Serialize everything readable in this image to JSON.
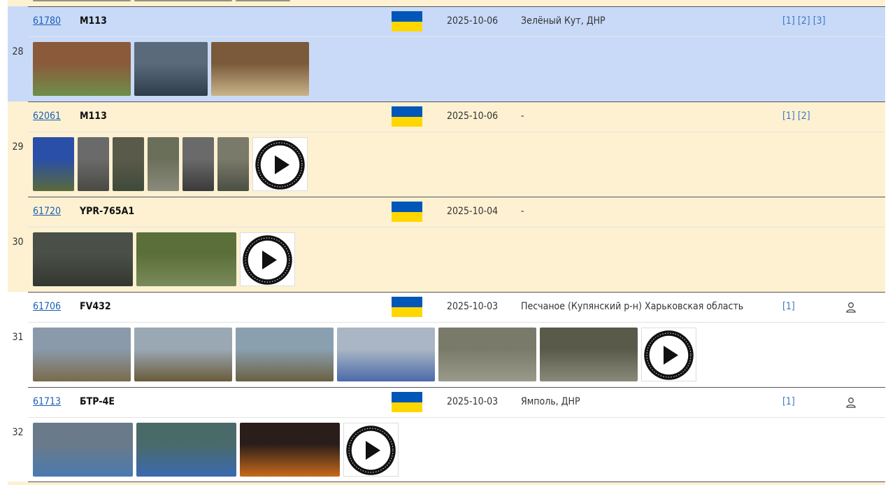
{
  "colors": {
    "row_blue": "#c9daf8",
    "row_yellow": "#fdf1d2",
    "link": "#1a5fb4",
    "flag_blue": "#0057b7",
    "flag_yellow": "#ffd700"
  },
  "rows": [
    {
      "num": "28",
      "bg": "blue",
      "id": "61780",
      "model": "M113",
      "flag": "ukraine-flag",
      "date": "2025-10-06",
      "location": "Зелёный Кут, ДНР",
      "links": [
        "[1]",
        "[2]",
        "[3]"
      ],
      "person": false,
      "thumbs": [
        {
          "w": 140,
          "c1": "#8a5a3a",
          "c2": "#6f8f4a"
        },
        {
          "w": 105,
          "c1": "#5a6a7a",
          "c2": "#2f3d4a"
        },
        {
          "w": 140,
          "c1": "#7a5a3a",
          "c2": "#c9b48a"
        }
      ],
      "video": false
    },
    {
      "num": "29",
      "bg": "yellow",
      "id": "62061",
      "model": "M113",
      "flag": "ukraine-flag",
      "date": "2025-10-06",
      "location": "-",
      "links": [
        "[1]",
        "[2]"
      ],
      "person": false,
      "thumbs": [
        {
          "w": 59,
          "c1": "#2a4fa8",
          "c2": "#5a6a3a"
        },
        {
          "w": 45,
          "c1": "#6a6a6a",
          "c2": "#4a4a44"
        },
        {
          "w": 45,
          "c1": "#5a5a4a",
          "c2": "#3f4a3a"
        },
        {
          "w": 45,
          "c1": "#6a6f5a",
          "c2": "#8a8a7a"
        },
        {
          "w": 45,
          "c1": "#6a6a6a",
          "c2": "#3a3a3a"
        },
        {
          "w": 45,
          "c1": "#7a7a6a",
          "c2": "#4a4f44"
        }
      ],
      "video": true
    },
    {
      "num": "30",
      "bg": "yellow",
      "id": "61720",
      "model": "YPR-765A1",
      "flag": "ukraine-flag",
      "date": "2025-10-04",
      "location": "-",
      "links": [],
      "person": false,
      "thumbs": [
        {
          "w": 143,
          "c1": "#4a4f48",
          "c2": "#33372f"
        },
        {
          "w": 143,
          "c1": "#5a6f3a",
          "c2": "#7a8a5a"
        }
      ],
      "video": true
    },
    {
      "num": "31",
      "bg": "white",
      "id": "61706",
      "model": "FV432",
      "flag": "ukraine-flag",
      "date": "2025-10-03",
      "location": "Песчаное (Купянский р-н) Харьковская область",
      "links": [
        "[1]"
      ],
      "person": true,
      "thumbs": [
        {
          "w": 140,
          "c1": "#8a9aaa",
          "c2": "#7a6a4a"
        },
        {
          "w": 140,
          "c1": "#9aa8b4",
          "c2": "#6a5a3a"
        },
        {
          "w": 140,
          "c1": "#8aa0b0",
          "c2": "#6a6040"
        },
        {
          "w": 140,
          "c1": "#aab6c4",
          "c2": "#4a6aa8"
        },
        {
          "w": 140,
          "c1": "#7a7a6a",
          "c2": "#9a9a8a"
        },
        {
          "w": 140,
          "c1": "#5a5a4a",
          "c2": "#8a8a7a"
        }
      ],
      "video": true
    },
    {
      "num": "32",
      "bg": "white",
      "id": "61713",
      "model": "БТР-4Е",
      "flag": "ukraine-flag",
      "date": "2025-10-03",
      "location": "Ямполь, ДНР",
      "links": [
        "[1]"
      ],
      "person": true,
      "thumbs": [
        {
          "w": 143,
          "c1": "#6a7a8a",
          "c2": "#4a7ab0"
        },
        {
          "w": 143,
          "c1": "#4a6a6a",
          "c2": "#3a6ab0"
        },
        {
          "w": 143,
          "c1": "#2a1e1a",
          "c2": "#c86a1a"
        }
      ],
      "video": true
    }
  ]
}
